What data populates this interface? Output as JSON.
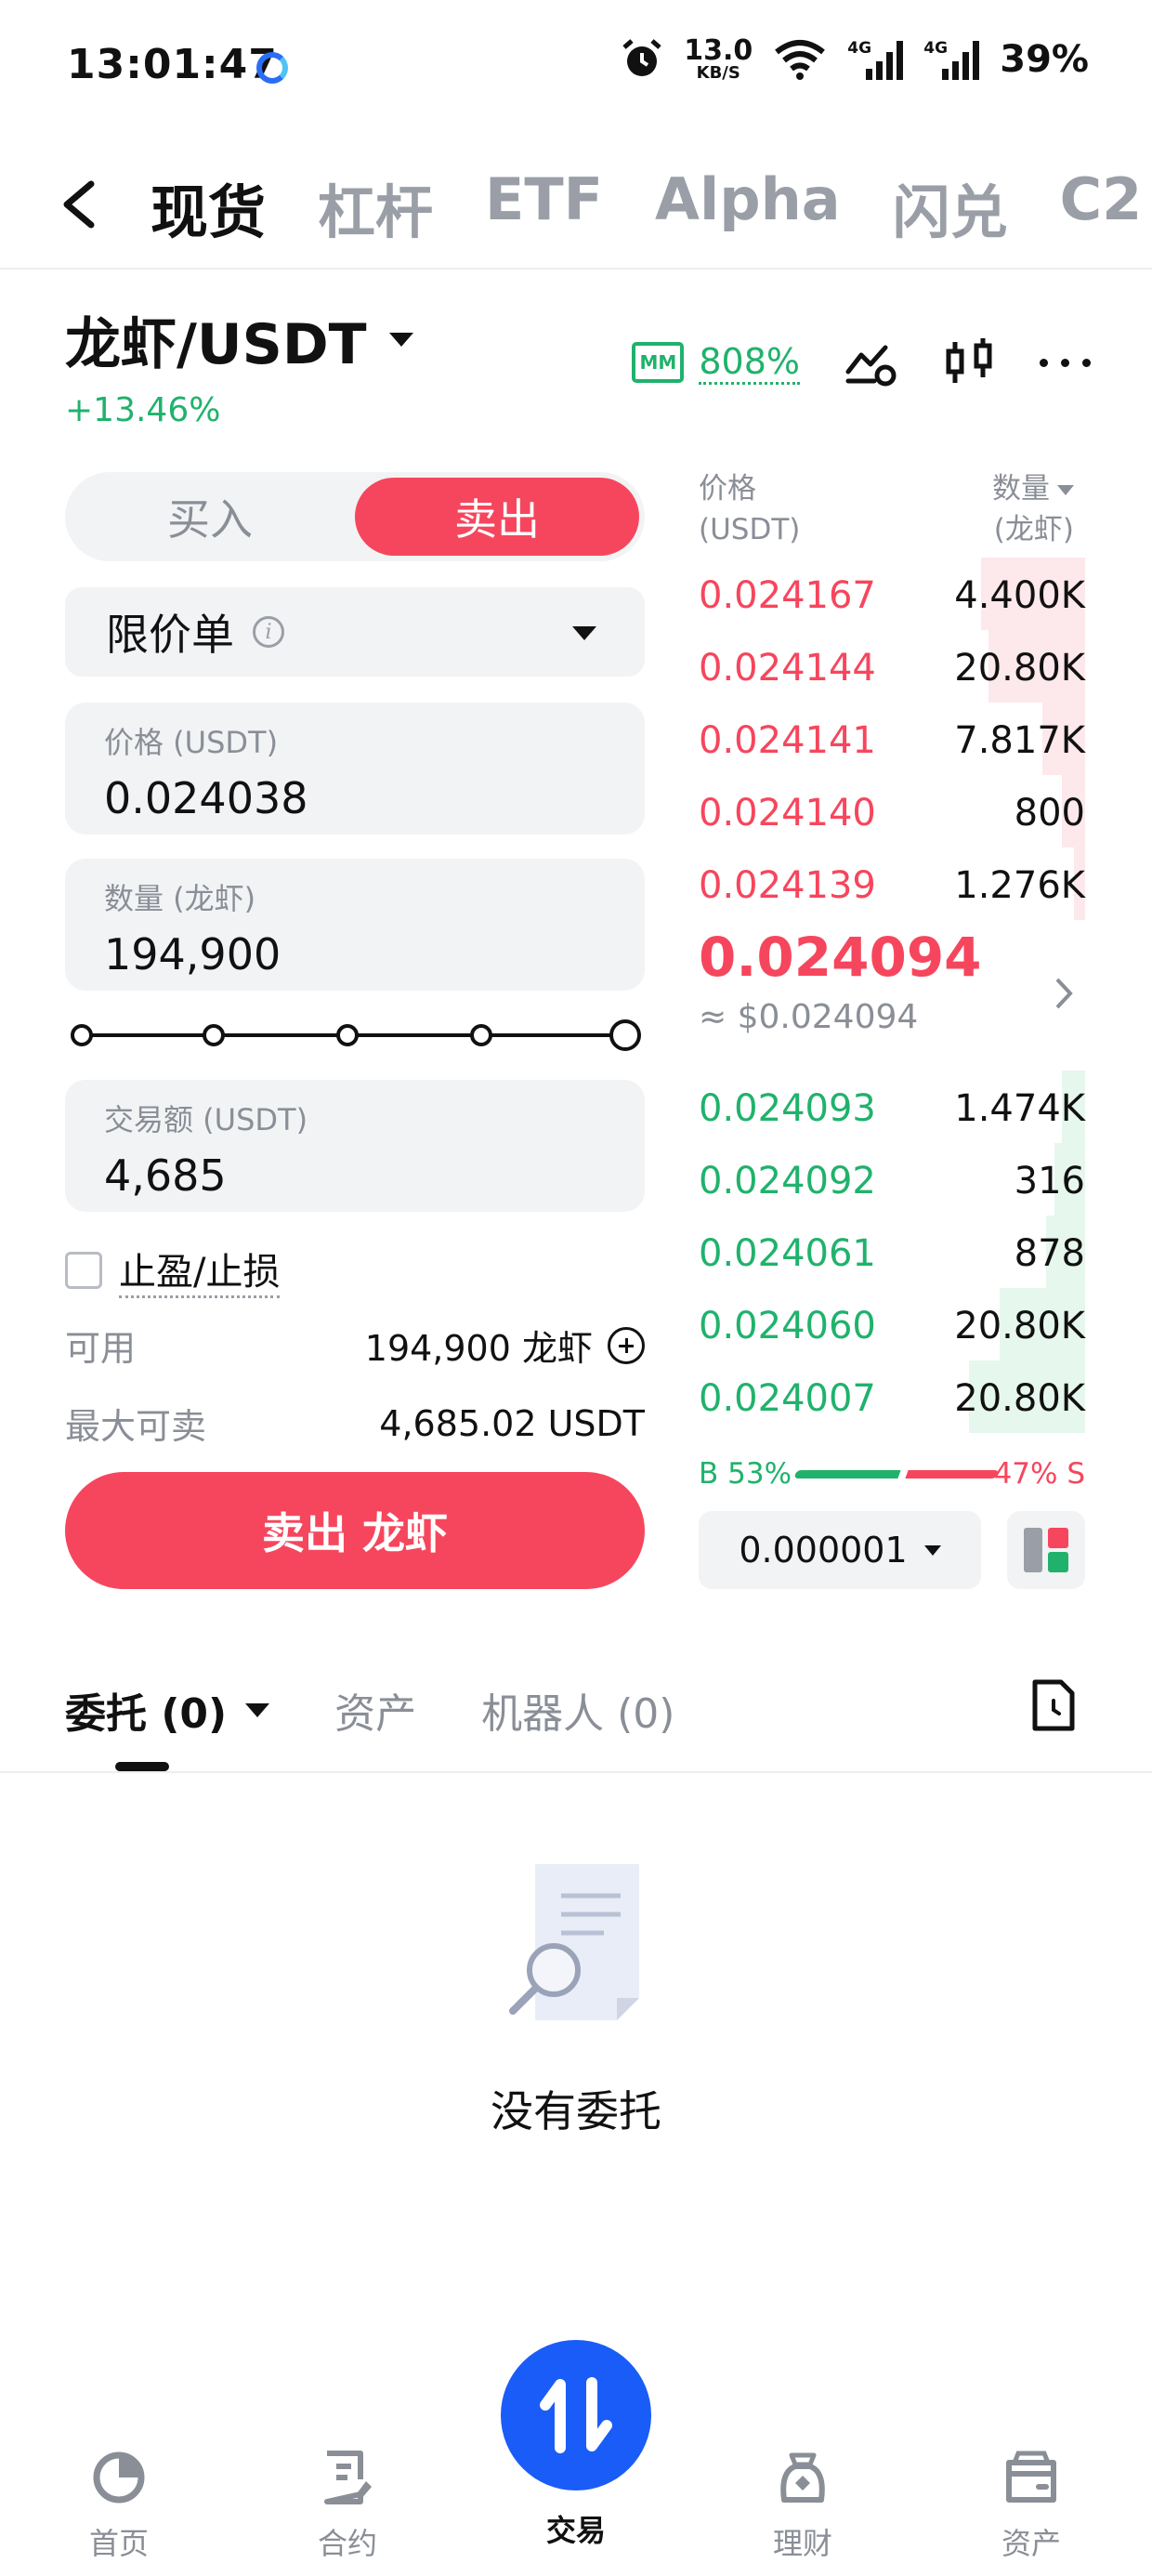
{
  "status_bar": {
    "time": "13:01:47",
    "net_speed_value": "13.0",
    "net_speed_unit": "KB/S",
    "signal1_tag": "4G",
    "signal2_tag": "4G",
    "battery": "39%"
  },
  "top_nav": {
    "tabs": [
      {
        "label": "现货",
        "active": true
      },
      {
        "label": "杠杆",
        "active": false
      },
      {
        "label": "ETF",
        "active": false
      },
      {
        "label": "Alpha",
        "active": false
      },
      {
        "label": "闪兑",
        "active": false
      },
      {
        "label": "C2",
        "active": false
      }
    ]
  },
  "pair": {
    "name": "龙虾/USDT",
    "change": "+13.46%",
    "mm_badge": "MM",
    "mm_value": "808%"
  },
  "order_form": {
    "buy_label": "买入",
    "sell_label": "卖出",
    "order_type": "限价单",
    "price_label": "价格 (USDT)",
    "price_value": "0.024038",
    "qty_label": "数量 (龙虾)",
    "qty_value": "194,900",
    "slider_percent": 100,
    "amount_label": "交易额 (USDT)",
    "amount_value": "4,685",
    "tpsl_label": "止盈/止损",
    "available_label": "可用",
    "available_value": "194,900 龙虾",
    "max_sell_label": "最大可卖",
    "max_sell_value": "4,685.02 USDT",
    "submit_label": "卖出 龙虾"
  },
  "order_book": {
    "price_header": "价格",
    "price_unit": "(USDT)",
    "qty_header": "数量",
    "qty_unit": "(龙虾)",
    "asks": [
      {
        "price": "0.024167",
        "qty": "4.400K",
        "depth": 0.27
      },
      {
        "price": "0.024144",
        "qty": "20.80K",
        "depth": 0.25
      },
      {
        "price": "0.024141",
        "qty": "7.817K",
        "depth": 0.11
      },
      {
        "price": "0.024140",
        "qty": "800",
        "depth": 0.06
      },
      {
        "price": "0.024139",
        "qty": "1.276K",
        "depth": 0.03
      }
    ],
    "last_price": "0.024094",
    "last_price_usd": "≈ $0.024094",
    "bids": [
      {
        "price": "0.024093",
        "qty": "1.474K",
        "depth": 0.06
      },
      {
        "price": "0.024092",
        "qty": "316",
        "depth": 0.08
      },
      {
        "price": "0.024061",
        "qty": "878",
        "depth": 0.1
      },
      {
        "price": "0.024060",
        "qty": "20.80K",
        "depth": 0.22
      },
      {
        "price": "0.024007",
        "qty": "20.80K",
        "depth": 0.3
      }
    ],
    "buy_ratio_label": "B 53%",
    "sell_ratio_label": "47% S",
    "precision": "0.000001"
  },
  "orders_section": {
    "tabs": [
      {
        "label": "委托 (0)",
        "active": true
      },
      {
        "label": "资产",
        "active": false
      },
      {
        "label": "机器人 (0)",
        "active": false
      }
    ],
    "empty_text": "没有委托"
  },
  "bottom_nav": {
    "items": [
      {
        "label": "首页",
        "icon": "home-icon"
      },
      {
        "label": "合约",
        "icon": "futures-icon"
      },
      {
        "label": "交易",
        "icon": "trade-icon",
        "active": true
      },
      {
        "label": "理财",
        "icon": "earn-icon"
      },
      {
        "label": "资产",
        "icon": "wallet-icon"
      }
    ]
  },
  "colors": {
    "sell_red": "#f6465d",
    "buy_green": "#20b26c",
    "trade_blue": "#1a5cf8"
  }
}
